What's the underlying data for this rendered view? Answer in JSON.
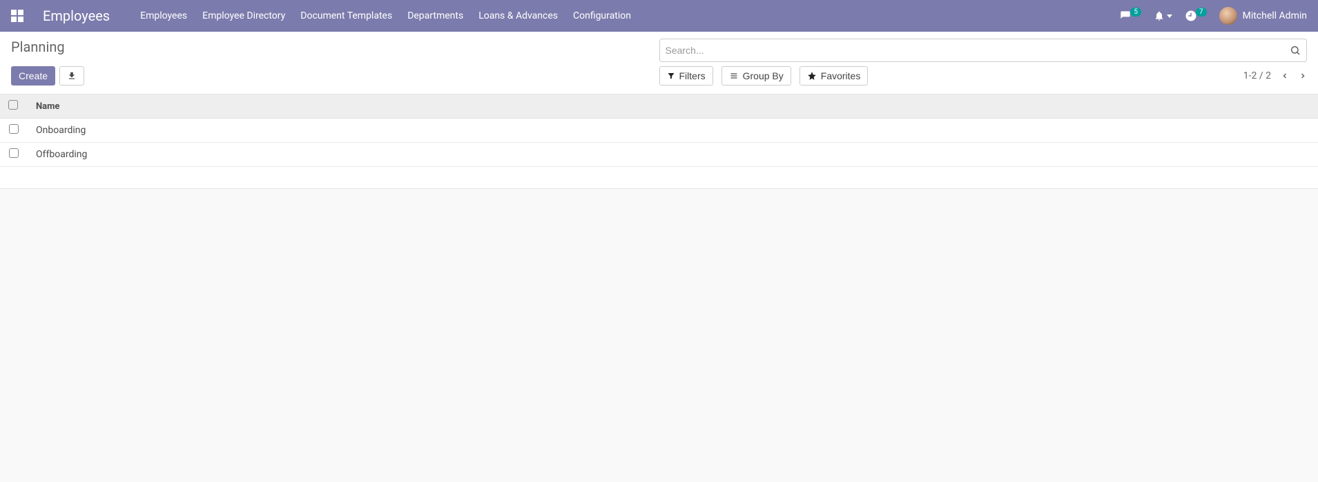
{
  "navbar": {
    "brand": "Employees",
    "menu": [
      {
        "label": "Employees"
      },
      {
        "label": "Employee Directory"
      },
      {
        "label": "Document Templates"
      },
      {
        "label": "Departments"
      },
      {
        "label": "Loans & Advances"
      },
      {
        "label": "Configuration"
      }
    ],
    "messages_badge": "5",
    "activities_badge": "7",
    "user_name": "Mitchell Admin"
  },
  "control_panel": {
    "breadcrumb": "Planning",
    "create_label": "Create",
    "search_placeholder": "Search...",
    "filters_label": "Filters",
    "groupby_label": "Group By",
    "favorites_label": "Favorites",
    "pager": "1-2 / 2"
  },
  "list": {
    "columns": [
      {
        "label": "Name"
      }
    ],
    "rows": [
      {
        "name": "Onboarding"
      },
      {
        "name": "Offboarding"
      }
    ]
  }
}
